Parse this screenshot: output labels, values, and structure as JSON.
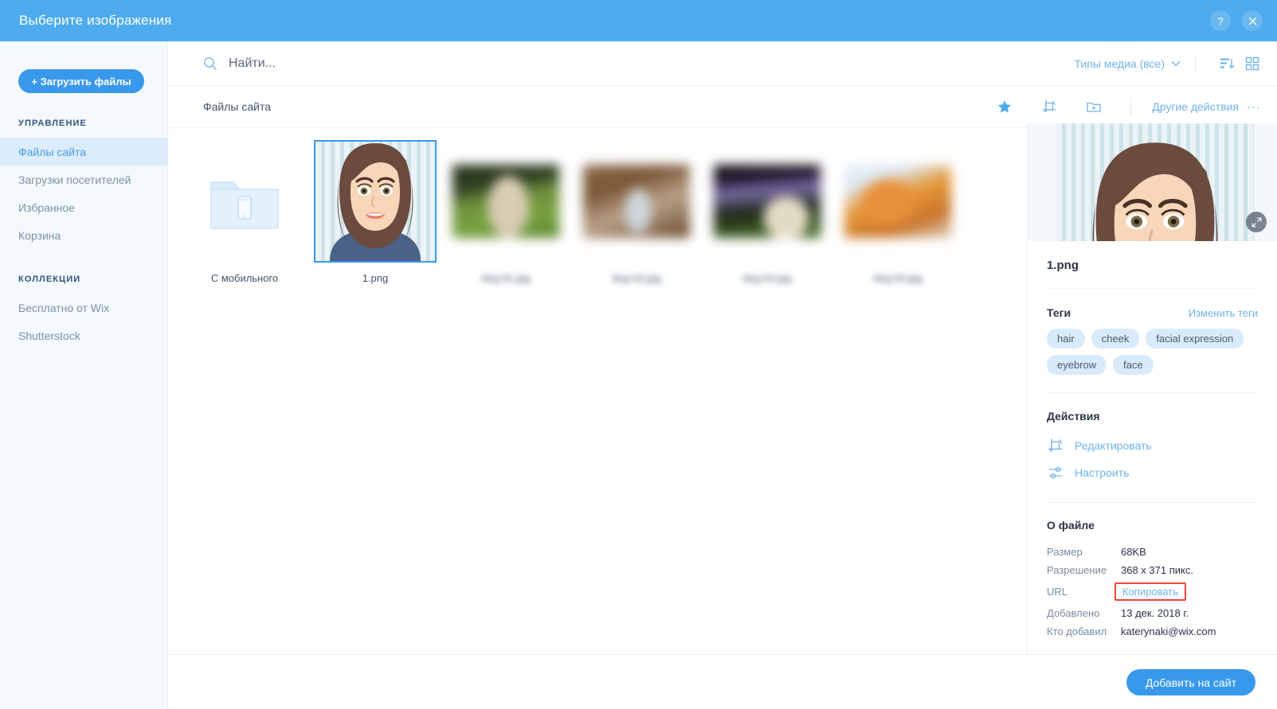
{
  "window": {
    "title": "Выберите изображения",
    "help_icon": "question-mark-icon",
    "close_icon": "close-icon"
  },
  "sidebar": {
    "upload_button": "+ Загрузить файлы",
    "groups": [
      {
        "title": "УПРАВЛЕНИЕ",
        "items": [
          {
            "label": "Файлы сайта",
            "active": true
          },
          {
            "label": "Загрузки посетителей",
            "active": false
          },
          {
            "label": "Избранное",
            "active": false
          },
          {
            "label": "Корзина",
            "active": false
          }
        ]
      },
      {
        "title": "КОЛЛЕКЦИИ",
        "items": [
          {
            "label": "Бесплатно от Wix",
            "active": false
          },
          {
            "label": "Shutterstock",
            "active": false
          }
        ]
      }
    ]
  },
  "search": {
    "placeholder": "Найти...",
    "value": "",
    "icon": "search-icon"
  },
  "toolbar": {
    "media_type_label": "Типы медиа (все)",
    "media_type_caret": "chevron-down-icon",
    "sort_icon": "sort-descending-icon",
    "view_icon": "grid-view-icon"
  },
  "breadcrumb": {
    "path": "Файлы сайта",
    "icons": [
      "star-icon",
      "crop-rotate-icon",
      "new-folder-icon"
    ],
    "more_actions_label": "Другие действия",
    "more_actions_dots": "···"
  },
  "grid": {
    "items": [
      {
        "label": "С мобильного",
        "kind": "folder",
        "selected": false,
        "blurred": false
      },
      {
        "label": "1.png",
        "kind": "avatar",
        "selected": true,
        "blurred": false
      },
      {
        "label": "dog-01.jpg",
        "kind": "photo0",
        "selected": false,
        "blurred": true
      },
      {
        "label": "dog-02.jpg",
        "kind": "photo1",
        "selected": false,
        "blurred": true
      },
      {
        "label": "dog-03.jpg",
        "kind": "photo2",
        "selected": false,
        "blurred": true
      },
      {
        "label": "dog-04.jpg",
        "kind": "photo3",
        "selected": false,
        "blurred": true
      }
    ]
  },
  "details": {
    "preview_expand_icon": "expand-icon",
    "file_name": "1.png",
    "tags_title": "Теги",
    "tags_edit_link": "Изменить теги",
    "tags": [
      "hair",
      "cheek",
      "facial expression",
      "eyebrow",
      "face"
    ],
    "actions_title": "Действия",
    "actions": [
      {
        "label": "Редактировать",
        "icon": "crop-rotate-icon"
      },
      {
        "label": "Настроить",
        "icon": "adjust-sliders-icon"
      }
    ],
    "about_title": "О файле",
    "about": [
      {
        "key": "Размер",
        "value": "68KB",
        "is_link": false,
        "highlighted": false
      },
      {
        "key": "Разрешение",
        "value": "368 x 371 пикс.",
        "is_link": false,
        "highlighted": false
      },
      {
        "key": "URL",
        "value": "Копировать",
        "is_link": true,
        "highlighted": true
      },
      {
        "key": "Добавлено",
        "value": "13 дек. 2018 г.",
        "is_link": false,
        "highlighted": false
      },
      {
        "key": "Кто добавил",
        "value": "katerynaki@wix.com",
        "is_link": false,
        "highlighted": false
      }
    ]
  },
  "footer": {
    "add_button": "Добавить на сайт"
  },
  "colors": {
    "title_bar": "#4eabee",
    "accent": "#3899ec",
    "link": "#6fb3ea",
    "sidebar_bg": "#f4f9fe",
    "sidebar_active_bg": "#dcecfb",
    "tag_bg": "#d9ebfa",
    "highlight_border": "#f4443a",
    "text_dark": "#2b3445",
    "text_muted": "#7a8b9c"
  }
}
